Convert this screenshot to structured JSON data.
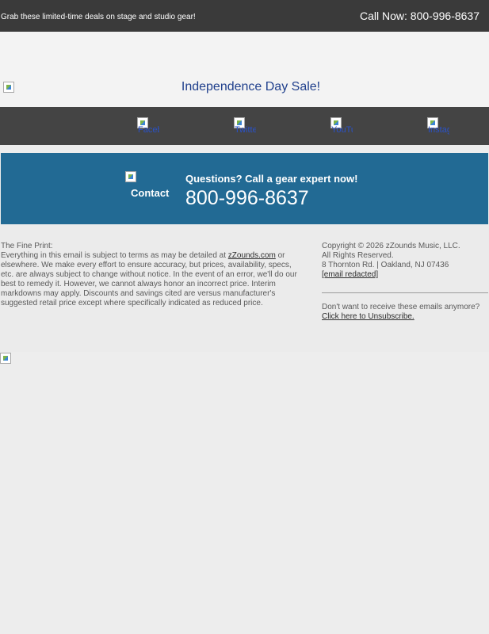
{
  "topbar": {
    "promo": "Grab these limited-time deals on stage and studio gear!",
    "phone": "Call Now: 800-996-8637"
  },
  "hero": {
    "alt": "Independence Day Sale!"
  },
  "social": [
    {
      "alt": "Facebook",
      "icon": "facebook-icon"
    },
    {
      "alt": "Twitter",
      "icon": "twitter-icon"
    },
    {
      "alt": "YouTube",
      "icon": "youtube-icon"
    },
    {
      "alt": "Instagram",
      "icon": "instagram-icon"
    }
  ],
  "callbox": {
    "contact_alt": "Contact",
    "question": "Questions? Call a gear expert now!",
    "phone": "800-996-8637"
  },
  "fine_print": {
    "heading": "The Fine Print:",
    "body_before_link": "Everything in this email is subject to terms as may be detailed at ",
    "link": "zZounds.com",
    "body_after_link": " or elsewhere. We make every effort to ensure accuracy, but prices, availability, specs, etc. are always subject to change without notice. In the event of an error, we'll do our best to remedy it. However, we cannot always honor an incorrect price. Interim markdowns may apply. Discounts and savings cited are versus manufacturer's suggested retail price except where specifically indicated as reduced price."
  },
  "company": {
    "copyright": "Copyright © 2026 zZounds Music, LLC.",
    "rights": "All Rights Reserved.",
    "address": "8 Thornton Rd. | Oakland, NJ 07436",
    "email": "[email redacted]",
    "unsub_prompt": "Don't want to receive these emails anymore?",
    "unsub_link": "Click here to Unsubscribe."
  }
}
